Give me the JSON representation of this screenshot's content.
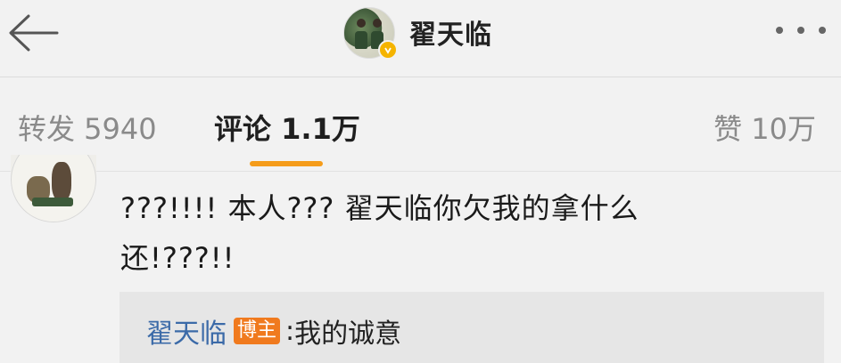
{
  "header": {
    "back_icon": "arrow-left-icon",
    "title": "翟天临",
    "more_icon": "more-horizontal-icon",
    "verified_color": "#f5b400"
  },
  "tabs": [
    {
      "label": "转发 5940",
      "active": false
    },
    {
      "label": "评论 1.1万",
      "active": true
    },
    {
      "label": "赞 10万",
      "active": false
    }
  ],
  "accent_color": "#f59c1a",
  "comment": {
    "line1": "???!!!! 本人??? 翟天临你欠我的拿什么",
    "line2": "还!???!!",
    "reply": {
      "author": "翟天临",
      "badge": "博主",
      "separator": ":",
      "text": "我的诚意"
    }
  }
}
